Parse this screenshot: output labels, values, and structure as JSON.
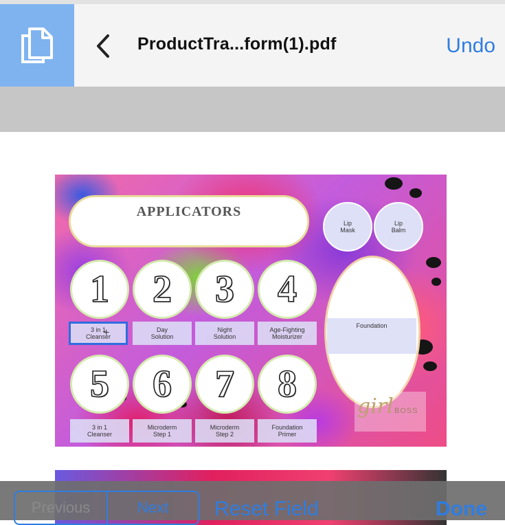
{
  "header": {
    "title": "ProductTra...form(1).pdf",
    "undo_label": "Undo"
  },
  "document": {
    "heading": "APPLICATORS",
    "top_circles": [
      {
        "label": "Lip\nMask"
      },
      {
        "label": "Lip\nBalm"
      }
    ],
    "numbers_row1": [
      "1",
      "2",
      "3",
      "4"
    ],
    "labels_row1": [
      "3 in 1\nCleanser",
      "Day\nSolution",
      "Night\nSolution",
      "Age-Fighting\nMoisturizer"
    ],
    "numbers_row2": [
      "5",
      "6",
      "7",
      "8"
    ],
    "labels_row2": [
      "3 in 1\nCleanser",
      "Microderm\nStep 1",
      "Microderm\nStep 2",
      "Foundation\nPrimer"
    ],
    "foundation_label": "Foundation",
    "logo_script": "girl",
    "logo_word": "BOSS"
  },
  "toolbar": {
    "previous_label": "Previous",
    "next_label": "Next",
    "reset_label": "Reset Field",
    "done_label": "Done"
  },
  "colors": {
    "accent": "#2f7de0",
    "doc_button_bg": "#7fb3f0"
  },
  "icons": {
    "doc_button": "documents-icon",
    "back": "chevron-left-icon"
  }
}
